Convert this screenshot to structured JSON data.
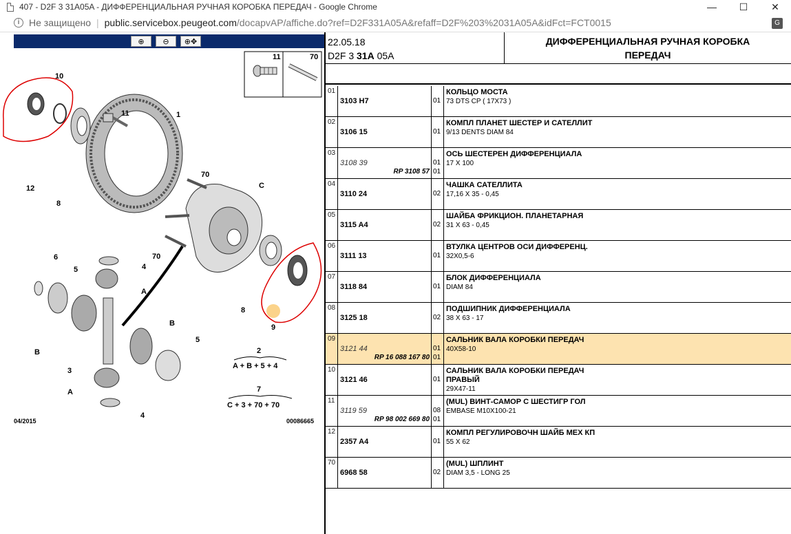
{
  "window": {
    "title": "407 - D2F 3 31A05A - ДИФФЕРЕНЦИАЛЬНАЯ РУЧНАЯ КОРОБКА ПЕРЕДАЧ - Google Chrome",
    "minimize": "—",
    "maximize": "☐",
    "close": "✕"
  },
  "address": {
    "security_label": "Не защищено",
    "separator": "|",
    "host": "public.servicebox.peugeot.com",
    "path": "/docapvAP/affiche.do?ref=D2F331A05A&refaff=D2F%203%2031A05A&idFct=FCT0015"
  },
  "diagram": {
    "toolbar": {
      "zoom_in": "⊕",
      "zoom_out": "⊖",
      "pan": "⊕✥"
    },
    "legend_top": {
      "item1": "11",
      "item2": "70"
    },
    "labels": {
      "l10": "10",
      "l11": "11",
      "l1": "1",
      "l12": "12",
      "l8a": "8",
      "l70a": "70",
      "lC": "C",
      "l70b": "70",
      "l6": "6",
      "l5a": "5",
      "l4a": "4",
      "lAa": "A",
      "l8b": "8",
      "l9": "9",
      "lBa": "B",
      "lBb": "B",
      "l5b": "5",
      "l3": "3",
      "lAb": "A",
      "l4b": "4"
    },
    "formula1_num": "2",
    "formula1": "A + B + 5 + 4",
    "formula2_num": "7",
    "formula2": "C + 3 + 70 + 70",
    "footer_left": "04/2015",
    "footer_right": "00086665"
  },
  "header": {
    "date": "22.05.18",
    "ref_prefix": "D2F 3 ",
    "ref_bold": "31A",
    "ref_suffix": " 05A",
    "title": "ДИФФЕРЕНЦИАЛЬНАЯ РУЧНАЯ КОРОБКА ПЕРЕДАЧ"
  },
  "parts": [
    {
      "idx": "01",
      "ref": "3103 H7",
      "italic": false,
      "rp": "",
      "qty1": "01",
      "qty2": "",
      "name": "КОЛЬЦО МОСТА",
      "name2": "",
      "spec": "73 DTS CP ( 17X73 )",
      "highlight": false
    },
    {
      "idx": "02",
      "ref": "3106 15",
      "italic": false,
      "rp": "",
      "qty1": "01",
      "qty2": "",
      "name": "КОМПЛ ПЛАНЕТ ШЕСТЕР И САТЕЛЛИТ",
      "name2": "",
      "spec": "9/13 DENTS DIAM 84",
      "highlight": false
    },
    {
      "idx": "03",
      "ref": "3108 39",
      "italic": true,
      "rp": "RP 3108 57",
      "qty1": "01",
      "qty2": "01",
      "name": "ОСЬ ШЕСТЕРЕН ДИФФЕРЕНЦИАЛА",
      "name2": "",
      "spec": "17 X 100",
      "highlight": false
    },
    {
      "idx": "04",
      "ref": "3110 24",
      "italic": false,
      "rp": "",
      "qty1": "02",
      "qty2": "",
      "name": "ЧАШКА САТЕЛЛИТА",
      "name2": "",
      "spec": "17,16 X 35 - 0,45",
      "highlight": false
    },
    {
      "idx": "05",
      "ref": "3115 A4",
      "italic": false,
      "rp": "",
      "qty1": "02",
      "qty2": "",
      "name": "ШАЙБА ФРИКЦИОН. ПЛАНЕТАРНАЯ",
      "name2": "",
      "spec": "31 X 63 - 0,45",
      "highlight": false
    },
    {
      "idx": "06",
      "ref": "3111 13",
      "italic": false,
      "rp": "",
      "qty1": "01",
      "qty2": "",
      "name": "ВТУЛКА ЦЕНТРОВ ОСИ ДИФФЕРЕНЦ.",
      "name2": "",
      "spec": "32X0,5-6",
      "highlight": false
    },
    {
      "idx": "07",
      "ref": "3118 84",
      "italic": false,
      "rp": "",
      "qty1": "01",
      "qty2": "",
      "name": "БЛОК ДИФФЕРЕНЦИАЛА",
      "name2": "",
      "spec": "DIAM 84",
      "highlight": false
    },
    {
      "idx": "08",
      "ref": "3125 18",
      "italic": false,
      "rp": "",
      "qty1": "02",
      "qty2": "",
      "name": "ПОДШИПНИК ДИФФЕРЕНЦИАЛА",
      "name2": "",
      "spec": "38 X 63 - 17",
      "highlight": false
    },
    {
      "idx": "09",
      "ref": "3121 44",
      "italic": true,
      "rp": "RP 16 088 167 80",
      "qty1": "01",
      "qty2": "01",
      "name": "САЛЬНИК ВАЛА КОРОБКИ ПЕРЕДАЧ",
      "name2": "",
      "spec": "40X58-10",
      "highlight": true
    },
    {
      "idx": "10",
      "ref": "3121 46",
      "italic": false,
      "rp": "",
      "qty1": "01",
      "qty2": "",
      "name": "САЛЬНИК ВАЛА КОРОБКИ ПЕРЕДАЧ",
      "name2": "ПРАВЫЙ",
      "spec": "29X47-11",
      "highlight": false
    },
    {
      "idx": "11",
      "ref": "3119 59",
      "italic": true,
      "rp": "RP 98 002 669 80",
      "qty1": "08",
      "qty2": "01",
      "name": "(MUL) ВИНТ-САМОР С ШЕСТИГР ГОЛ",
      "name2": "",
      "spec": "EMBASE M10X100-21",
      "highlight": false
    },
    {
      "idx": "12",
      "ref": "2357 A4",
      "italic": false,
      "rp": "",
      "qty1": "01",
      "qty2": "",
      "name": "КОМПЛ РЕГУЛИРОВОЧН ШАЙБ МЕХ КП",
      "name2": "",
      "spec": "55 X 62",
      "highlight": false
    },
    {
      "idx": "70",
      "ref": "6968 58",
      "italic": false,
      "rp": "",
      "qty1": "02",
      "qty2": "",
      "name": "(MUL) ШПЛИНТ",
      "name2": "",
      "spec": "DIAM 3,5 - LONG 25",
      "highlight": false
    }
  ]
}
